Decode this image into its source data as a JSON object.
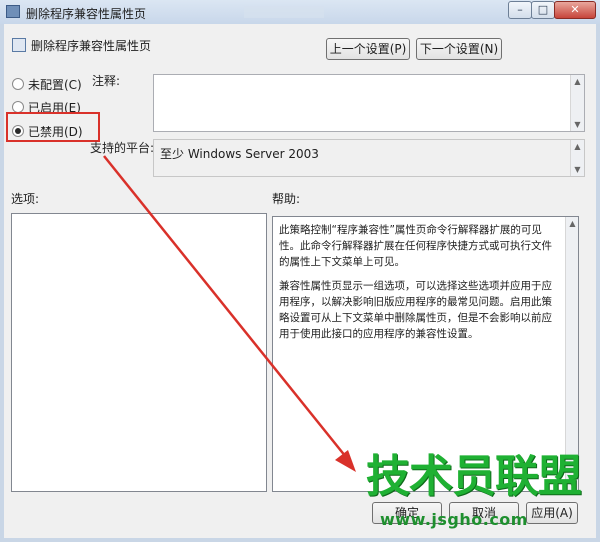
{
  "window": {
    "title": "删除程序兼容性属性页",
    "min_symbol": "–",
    "max_symbol": "□",
    "close_symbol": "✕"
  },
  "header": {
    "title": "删除程序兼容性属性页",
    "prev_button": "上一个设置(P)",
    "next_button": "下一个设置(N)"
  },
  "state_options": [
    {
      "label": "未配置(C)",
      "selected": false
    },
    {
      "label": "已启用(E)",
      "selected": false
    },
    {
      "label": "已禁用(D)",
      "selected": true
    }
  ],
  "comment": {
    "label": "注释:",
    "value": ""
  },
  "platform": {
    "label": "支持的平台:",
    "value": "至少 Windows Server 2003"
  },
  "options": {
    "label": "选项:"
  },
  "help": {
    "label": "帮助:",
    "paragraphs": [
      "此策略控制“程序兼容性”属性页命令行解释器扩展的可见性。此命令行解释器扩展在任何程序快捷方式或可执行文件的属性上下文菜单上可见。",
      "兼容性属性页显示一组选项，可以选择这些选项并应用于应用程序，以解决影响旧版应用程序的最常见问题。启用此策略设置可从上下文菜单中删除属性页，但是不会影响以前应用于使用此接口的应用程序的兼容性设置。"
    ]
  },
  "footer": {
    "ok": "确定",
    "cancel": "取消",
    "apply": "应用(A)"
  },
  "watermark": {
    "text": "技术员联盟",
    "url": "www.jsgho.com"
  },
  "colors": {
    "annotation": "#d9312a",
    "watermark": "#1fb133"
  },
  "icons": {
    "scroll_up": "▲",
    "scroll_down": "▼"
  }
}
